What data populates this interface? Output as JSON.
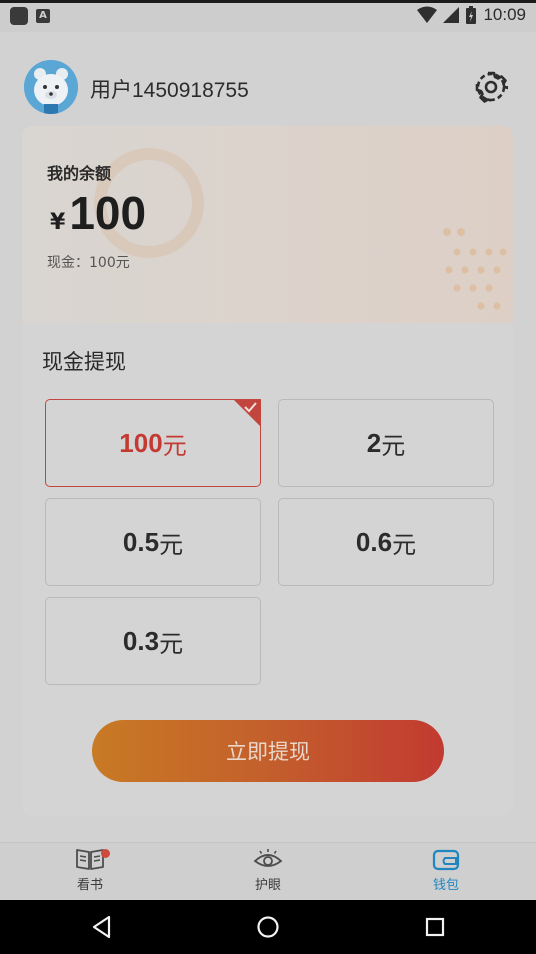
{
  "status_bar": {
    "time": "10:09",
    "left_icons": [
      "notification-square-icon",
      "keyboard-a-icon"
    ],
    "right_icons": [
      "wifi-icon",
      "signal-icon",
      "battery-icon"
    ]
  },
  "header": {
    "username": "用户1450918755",
    "avatar_icon": "polar-bear-avatar",
    "settings_icon": "gear-icon"
  },
  "balance": {
    "title": "我的余额",
    "currency_symbol": "¥",
    "amount": "100",
    "cash_label": "现金：100元"
  },
  "withdraw": {
    "section_title": "现金提现",
    "options": [
      {
        "value": "100",
        "unit": "元",
        "selected": true
      },
      {
        "value": "2",
        "unit": "元",
        "selected": false
      },
      {
        "value": "0.5",
        "unit": "元",
        "selected": false
      },
      {
        "value": "0.6",
        "unit": "元",
        "selected": false
      },
      {
        "value": "0.3",
        "unit": "元",
        "selected": false
      }
    ],
    "button_label": "立即提现"
  },
  "bottom_nav": {
    "items": [
      {
        "label": "看书",
        "icon": "book-icon",
        "active": false,
        "badge": true
      },
      {
        "label": "护眼",
        "icon": "eye-icon",
        "active": false,
        "badge": false
      },
      {
        "label": "钱包",
        "icon": "wallet-icon",
        "active": true,
        "badge": false
      }
    ]
  },
  "system_nav": [
    "back-icon",
    "home-icon",
    "recents-icon"
  ],
  "colors": {
    "accent_red": "#c43a33",
    "button_start": "#c87a24",
    "button_end": "#c23a31",
    "active_nav": "#1f86c0"
  }
}
